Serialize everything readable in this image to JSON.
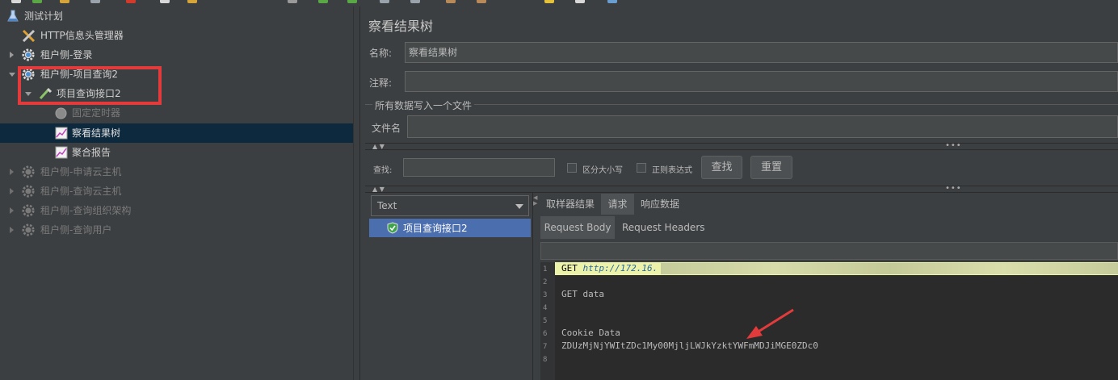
{
  "tree": {
    "root": "测试计划",
    "items": [
      {
        "label": "HTTP信息头管理器"
      },
      {
        "label": "租户侧-登录"
      },
      {
        "label": "租户侧-项目查询2"
      },
      {
        "label": "项目查询接口2"
      },
      {
        "label": "固定定时器"
      },
      {
        "label": "察看结果树"
      },
      {
        "label": "聚合报告"
      },
      {
        "label": "租户侧-申请云主机"
      },
      {
        "label": "租户侧-查询云主机"
      },
      {
        "label": "租户侧-查询组织架构"
      },
      {
        "label": "租户侧-查询用户"
      }
    ]
  },
  "panel": {
    "title": "察看结果树",
    "name_label": "名称:",
    "name_value": "察看结果树",
    "comment_label": "注释:",
    "comment_value": "",
    "write_all_label": "所有数据写入一个文件",
    "filename_label": "文件名",
    "filename_value": "",
    "search_label": "查找:",
    "search_value": "",
    "case_label": "区分大小写",
    "regex_label": "正则表达式",
    "find_button": "查找",
    "reset_button": "重置",
    "renderer_select": "Text",
    "sample_item": "项目查询接口2",
    "tabs": [
      "取样器结果",
      "请求",
      "响应数据"
    ],
    "subtabs": [
      "Request Body",
      "Request Headers"
    ]
  },
  "code": {
    "line_numbers": [
      "1",
      "2",
      "3",
      "4",
      "5",
      "6",
      "7",
      "8"
    ],
    "line1_method": "GET ",
    "line1_url": "http://172.16.",
    "line3": "GET data",
    "line6": "Cookie Data",
    "line7": "ZDUzMjNjYWItZDc1My00MjljLWJkYzktYWFmMDJiMGE0ZDc0"
  },
  "colors": {
    "highlight_box": "#e33b3b",
    "selection": "#0d293e",
    "list_selection": "#4b6eaf",
    "annotation_arrow": "#e33b3b"
  }
}
